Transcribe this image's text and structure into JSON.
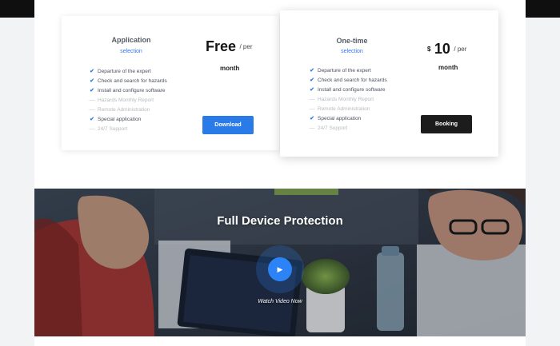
{
  "plans": [
    {
      "title": "Application",
      "subtitle": "selection",
      "price_main": "Free",
      "price_suffix": "/ per",
      "price_second_line": "month",
      "features": [
        {
          "label": "Departure of the expert",
          "included": true
        },
        {
          "label": "Check and search for hazards",
          "included": true
        },
        {
          "label": "Install and configure software",
          "included": true
        },
        {
          "label": "Hazards Monthly Report",
          "included": false
        },
        {
          "label": "Remote Administration",
          "included": false
        },
        {
          "label": "Special application",
          "included": true
        },
        {
          "label": "24/7 Support",
          "included": false
        }
      ],
      "button_label": "Download",
      "button_color": "#2a7ae8"
    },
    {
      "title": "One-time",
      "subtitle": "selection",
      "price_currency": "$",
      "price_main": "10",
      "price_suffix": "/ per",
      "price_second_line": "month",
      "features": [
        {
          "label": "Departure of the expert",
          "included": true
        },
        {
          "label": "Check and search for hazards",
          "included": true
        },
        {
          "label": "Install and configure software",
          "included": true
        },
        {
          "label": "Hazards Monthly Report",
          "included": false
        },
        {
          "label": "Remote Administration",
          "included": false
        },
        {
          "label": "Special application",
          "included": true
        },
        {
          "label": "24/7 Support",
          "included": false
        }
      ],
      "button_label": "Booking",
      "button_color": "#1c1c1c"
    }
  ],
  "icons": {
    "included": "check-icon",
    "excluded": "dash-icon",
    "video": "play-icon"
  },
  "hero": {
    "title": "Full Device Protection",
    "watch_label": "Watch Video Now"
  },
  "colors": {
    "accent": "#2f79e9",
    "hero_overlay": "#2a3038",
    "text_dark": "#151515"
  }
}
